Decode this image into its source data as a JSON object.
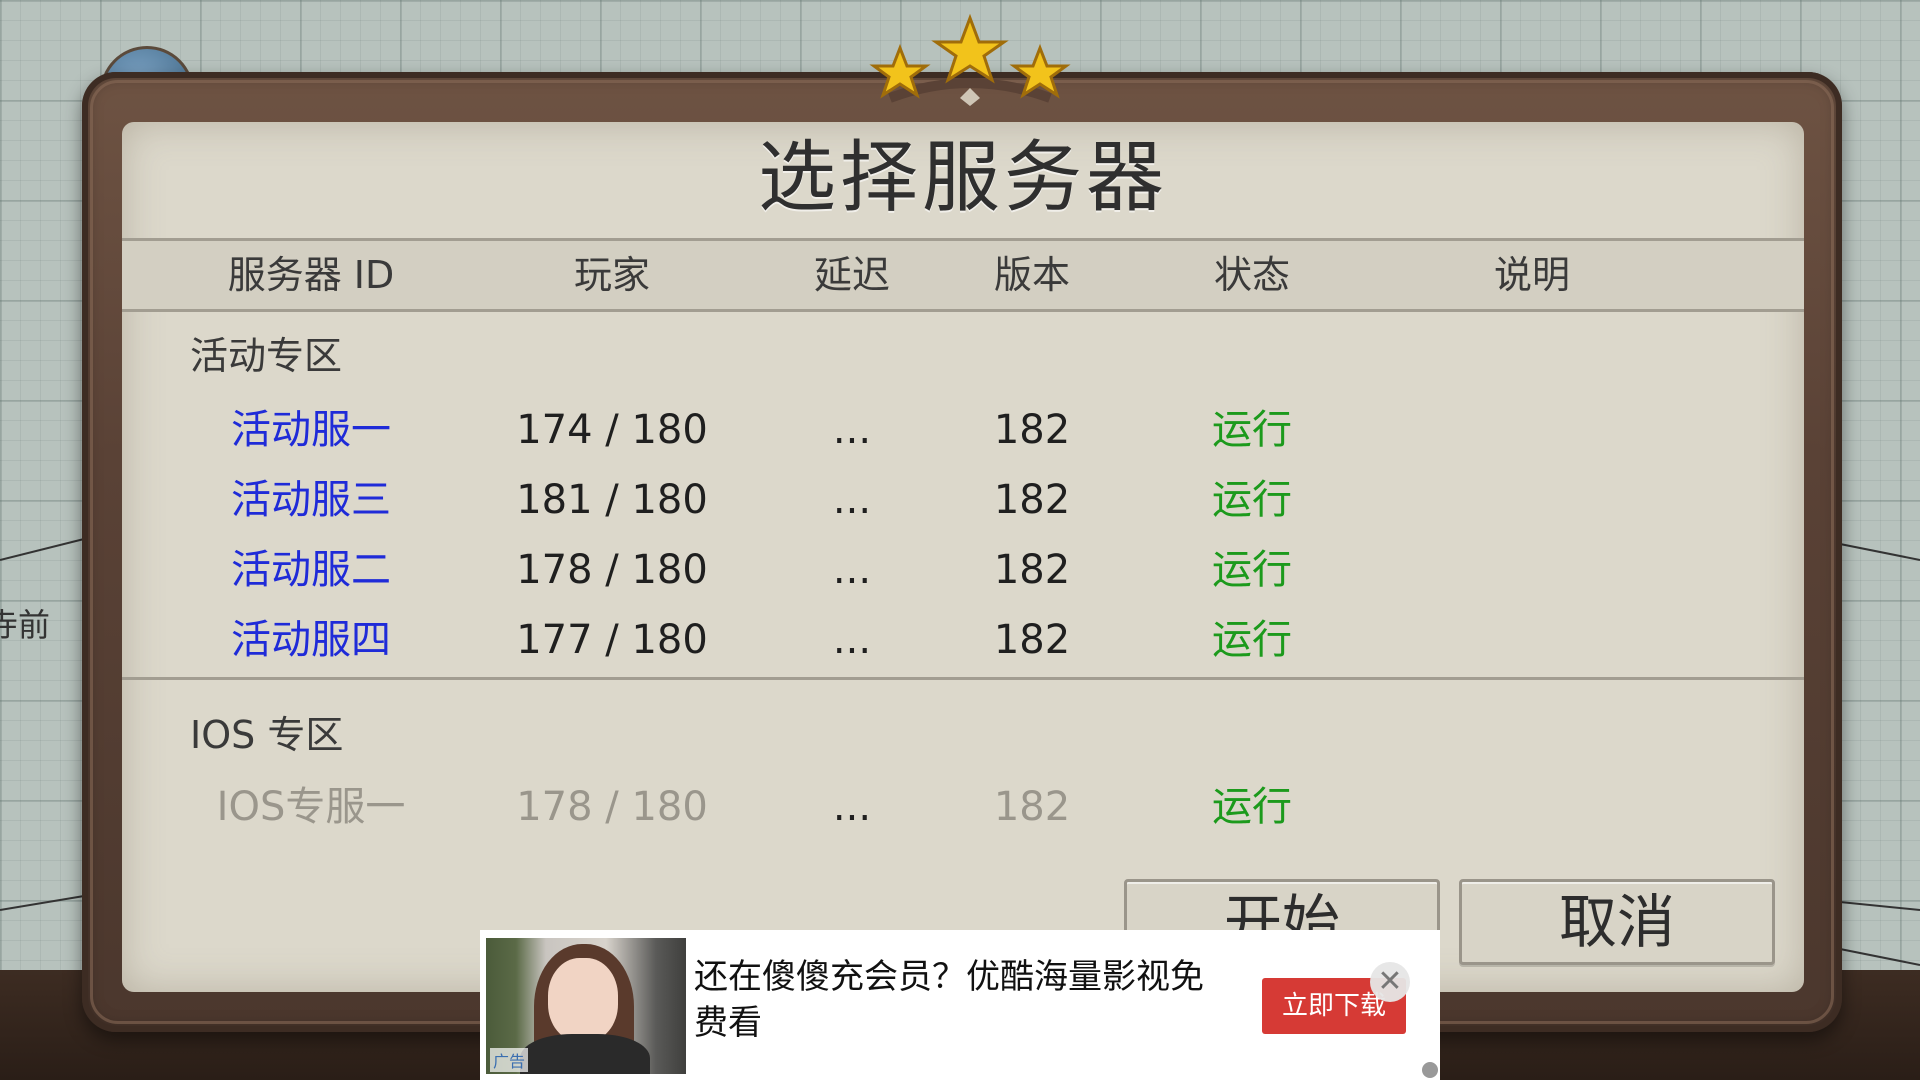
{
  "background": {
    "side_text": "寺前"
  },
  "dialog": {
    "title": "选择服务器",
    "columns": {
      "id": "服务器 ID",
      "players": "玩家",
      "latency": "延迟",
      "version": "版本",
      "status": "状态",
      "description": "说明"
    },
    "sections": [
      {
        "title": "活动专区",
        "rows": [
          {
            "name": "活动服一",
            "players": "174 / 180",
            "latency": "...",
            "version": "182",
            "status": "运行"
          },
          {
            "name": "活动服三",
            "players": "181 / 180",
            "latency": "...",
            "version": "182",
            "status": "运行"
          },
          {
            "name": "活动服二",
            "players": "178 / 180",
            "latency": "...",
            "version": "182",
            "status": "运行"
          },
          {
            "name": "活动服四",
            "players": "177 / 180",
            "latency": "...",
            "version": "182",
            "status": "运行"
          }
        ]
      },
      {
        "title": "IOS 专区",
        "rows": [
          {
            "name": "IOS专服一",
            "players": "178 / 180",
            "latency": "...",
            "version": "182",
            "status": "运行"
          }
        ]
      }
    ],
    "buttons": {
      "start": "开始",
      "cancel": "取消"
    }
  },
  "ad": {
    "text": "还在傻傻充会员？优酷海量影视免费看",
    "cta": "立即下载",
    "tag": "广告",
    "close": "✕"
  },
  "colors": {
    "server_name": "#1f2bd8",
    "status_running": "#1c9a1c",
    "disabled": "#9a968c",
    "ad_cta": "#d63a35"
  }
}
